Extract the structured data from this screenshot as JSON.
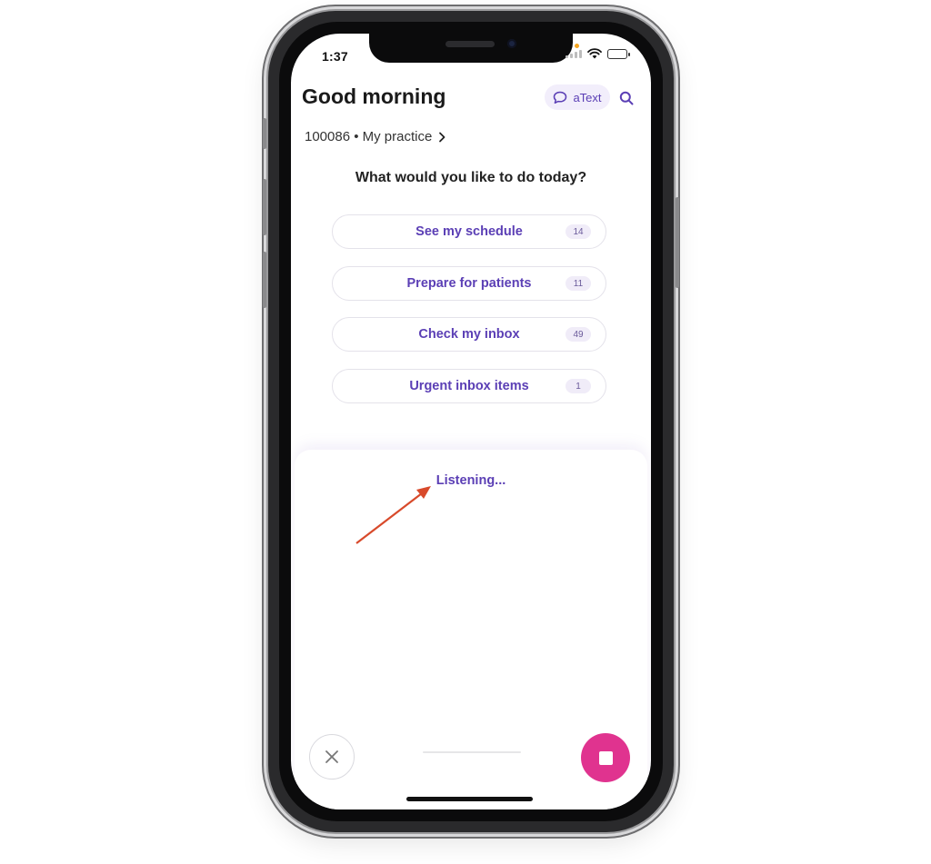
{
  "status_bar": {
    "time": "1:37"
  },
  "header": {
    "greeting": "Good morning",
    "atext_label": "aText",
    "atext_icon": "chat-bubble-icon",
    "search_icon": "search-icon"
  },
  "practice": {
    "label": "100086 • My practice",
    "chevron_icon": "chevron-right-icon"
  },
  "prompt": "What would you like to do today?",
  "actions": [
    {
      "label": "See my schedule",
      "count": "14"
    },
    {
      "label": "Prepare for patients",
      "count": "11"
    },
    {
      "label": "Check my inbox",
      "count": "49"
    },
    {
      "label": "Urgent inbox items",
      "count": "1"
    }
  ],
  "voice": {
    "status": "Listening...",
    "close_icon": "close-icon",
    "stop_icon": "stop-icon"
  },
  "colors": {
    "accent": "#5b3fb5",
    "stop_button": "#e0338f",
    "annotation_arrow": "#d84a2b"
  }
}
